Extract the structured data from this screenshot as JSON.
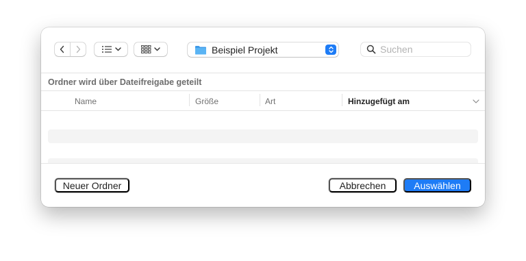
{
  "toolbar": {
    "back_icon": "chevron-left-icon",
    "forward_icon": "chevron-right-icon",
    "view_list_icon": "list-icon",
    "view_grid_icon": "grid-icon",
    "location": {
      "folder_name": "Beispiel Projekt",
      "folder_color": "#4aa6ee",
      "icon": "folder-icon"
    },
    "search": {
      "placeholder": "Suchen",
      "value": ""
    }
  },
  "share_note": "Ordner wird über Dateifreigabe geteilt",
  "columns": {
    "name": "Name",
    "size": "Größe",
    "kind": "Art",
    "date_added": "Hinzugefügt am",
    "sort_icon": "chevron-down-icon"
  },
  "footer": {
    "new_folder_label": "Neuer Ordner",
    "cancel_label": "Abbrechen",
    "choose_label": "Auswählen"
  },
  "colors": {
    "accent": "#1e7cf6"
  }
}
